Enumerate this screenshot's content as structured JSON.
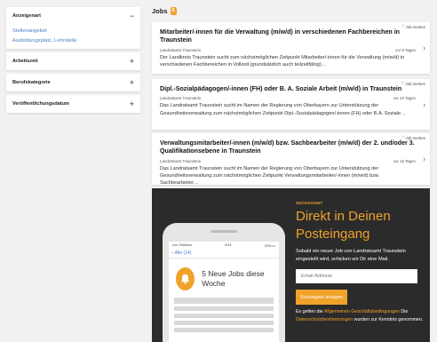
{
  "sidebar": {
    "filters": [
      {
        "label": "Anzeigenart",
        "toggle": "−",
        "options": [
          "Stellenangebot",
          "Ausbildungsplatz, Lehrstelle"
        ]
      },
      {
        "label": "Arbeitszeit",
        "toggle": "+"
      },
      {
        "label": "Berufskategorie",
        "toggle": "+"
      },
      {
        "label": "Veröffentlichungsdatum",
        "toggle": "+"
      }
    ]
  },
  "jobs": {
    "title": "Jobs",
    "count": "6",
    "remember_label": "Job merken",
    "items": [
      {
        "title": "Mitarbeiter/-innen für die Verwaltung (m/w/d) in verschiedenen Fachbereichen in Traunstein",
        "employer": "Landratsamt Traunstein",
        "age": "vor 8 Tagen",
        "description": "Der Landkreis Traunstein sucht zum nächstmöglichen Zeitpunkt Mitarbeiter/-innen für die Verwaltung (m/w/d) in verschiedenen Fachbereichen in Vollzeit (grundsätzlich auch teilzeitfähig)…"
      },
      {
        "title": "Dipl.-Sozialpädagogen/-innen (FH) oder B. A. Soziale Arbeit (m/w/d) in Traunstein",
        "employer": "Landratsamt Traunstein",
        "age": "vor 10 Tagen",
        "description": "Das Landratsamt Traunstein sucht im Namen der Regierung von Oberbayern zur Unterstützung der Gesundheitsverwaltung zum nächstmöglichen Zeitpunkt Dipl.-Sozialpädagogen/-innen (FH) oder B.A. Soziale…"
      },
      {
        "title": "Verwaltungsmitarbeiter/-innen (m/w/d) bzw. Sachbearbeiter (m/w/d) der 2. und/oder 3. Qualifikationsebene in Traunstein",
        "employer": "Landratsamt Traunstein",
        "age": "vor 16 Tagen",
        "description": "Das Landratsamt Traunstein sucht im Namen der Regierung von Oberbayern zur Unterstützung der Gesundheitsverwaltung zum nächstmöglichen Zeitpunkt Verwaltungsmitarbeiter/-innen (m/w/d) bzw. Sachbearbeiter…"
      }
    ]
  },
  "newsletter": {
    "eyebrow": "SUCHAGENT",
    "headline": "Direkt in Deinen Posteingang",
    "text": "Sobald ein neuer Job von Landratsamt Traunstein eingestellt wird, schicken wir Dir eine Mail.",
    "email_placeholder": "Email-Adresse",
    "submit_label": "Suchagent anlegen",
    "legal_prefix": "Es gelten die ",
    "legal_link1": "Allgemeinen Geschäftsbedingungen",
    "legal_middle": " Die ",
    "legal_link2": "Datenschutzbestimmungen",
    "legal_suffix": " wurden zur Kenntnis genommen."
  },
  "phone": {
    "carrier": "••••• Telekom",
    "time": "9:41",
    "battery": "22% ▭",
    "back_label": "‹ Alle (14)",
    "notification": "5 Neue Jobs diese Woche"
  },
  "colors": {
    "accent": "#f0a22b",
    "link": "#4a7fc4",
    "banner_bg": "#2b2b2b"
  }
}
